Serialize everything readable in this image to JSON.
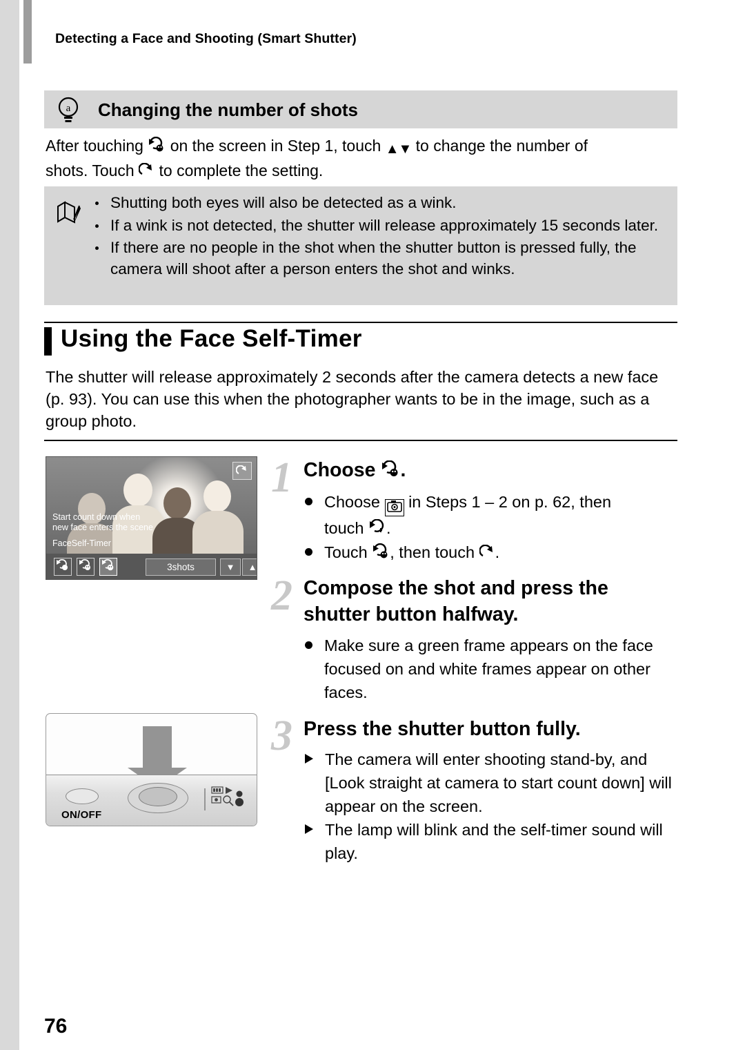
{
  "running_header": "Detecting a Face and Shooting (Smart Shutter)",
  "tip": {
    "icon": "lightbulb-icon",
    "title": "Changing the number of shots",
    "body_before_icon": "After touching",
    "body_mid1": "on the screen in Step 1, touch",
    "body_mid2": "to change the number of",
    "body_line2_a": "shots. Touch",
    "body_line2_b": "to complete the setting."
  },
  "notes": {
    "icon": "pencil-note-icon",
    "items": [
      "Shutting both eyes will also be detected as a wink.",
      "If a wink is not detected, the shutter will release approximately 15 seconds later.",
      "If there are no people in the shot when the shutter button is pressed fully, the camera will shoot after a person enters the shot and winks."
    ]
  },
  "section": {
    "title": "Using the Face Self-Timer",
    "intro": "The shutter will release approximately 2 seconds after the camera detects a new face (p. 93). You can use this when the photographer wants to be in the image, such as a group photo."
  },
  "screen_illo": {
    "caption_line1": "Start count down when",
    "caption_line2": "new face enters the scene",
    "mode_label": "FaceSelf-Timer",
    "shots_value": "3shots",
    "back_icon": "back-arrow-icon",
    "down_arrow": "▼",
    "up_arrow": "▲"
  },
  "steps": [
    {
      "number": "1",
      "heading_text": "Choose",
      "heading_icon": "face-self-timer-icon",
      "bullets": [
        {
          "text_a": "Choose",
          "icon": "smart-shutter-icon",
          "text_b": "in Steps 1 – 2 on p. 62, then",
          "text_c": "touch",
          "icon2": "timer-icon",
          "text_d": "."
        },
        {
          "text_a": "Touch",
          "icon": "face-self-timer-icon",
          "text_b": ", then touch",
          "icon2": "back-arrow-icon",
          "text_c": "."
        }
      ]
    },
    {
      "number": "2",
      "heading": "Compose the shot and press the shutter button halfway.",
      "bullets": [
        "Make sure a green frame appears on the face focused on and white frames appear on other faces."
      ]
    },
    {
      "number": "3",
      "heading": "Press the shutter button fully.",
      "arrows": [
        "The camera will enter shooting stand-by, and [Look straight at camera to start count down] will appear on the screen.",
        "The lamp will blink and the self-timer sound will play."
      ]
    }
  ],
  "camera_illo": {
    "onoff_label": "ON/OFF",
    "shutter_button": "shutter-button",
    "arrow": "press-down-arrow"
  },
  "page_number": "76"
}
